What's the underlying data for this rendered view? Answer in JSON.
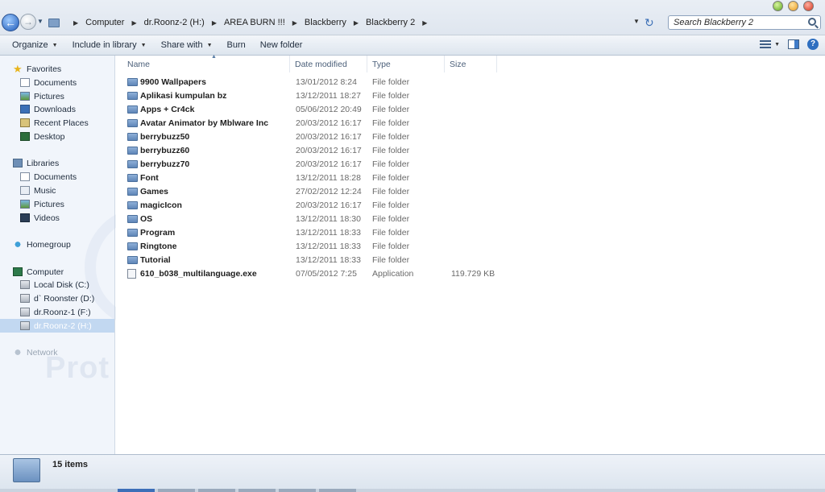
{
  "breadcrumb": [
    "Computer",
    "dr.Roonz-2 (H:)",
    "AREA BURN !!!",
    "Blackberry",
    "Blackberry 2"
  ],
  "search": {
    "placeholder": "Search Blackberry 2"
  },
  "toolbar": {
    "organize": "Organize",
    "include_in_library": "Include in library",
    "share_with": "Share with",
    "burn": "Burn",
    "new_folder": "New folder"
  },
  "nav": {
    "favorites": {
      "label": "Favorites",
      "items": [
        "Documents",
        "Pictures",
        "Downloads",
        "Recent Places",
        "Desktop"
      ]
    },
    "libraries": {
      "label": "Libraries",
      "items": [
        "Documents",
        "Music",
        "Pictures",
        "Videos"
      ]
    },
    "homegroup": "Homegroup",
    "computer": {
      "label": "Computer",
      "items": [
        "Local Disk (C:)",
        "d` Roonster (D:)",
        "dr.Roonz-1 (F:)",
        "dr.Roonz-2 (H:)"
      ]
    },
    "network": "Network"
  },
  "columns": {
    "name": "Name",
    "date": "Date modified",
    "type": "Type",
    "size": "Size"
  },
  "files": [
    {
      "name": "9900 Wallpapers",
      "date": "13/01/2012 8:24",
      "type": "File folder",
      "size": ""
    },
    {
      "name": "Aplikasi kumpulan bz",
      "date": "13/12/2011 18:27",
      "type": "File folder",
      "size": ""
    },
    {
      "name": "Apps + Cr4ck",
      "date": "05/06/2012 20:49",
      "type": "File folder",
      "size": ""
    },
    {
      "name": "Avatar Animator by Mblware Inc",
      "date": "20/03/2012 16:17",
      "type": "File folder",
      "size": ""
    },
    {
      "name": "berrybuzz50",
      "date": "20/03/2012 16:17",
      "type": "File folder",
      "size": ""
    },
    {
      "name": "berrybuzz60",
      "date": "20/03/2012 16:17",
      "type": "File folder",
      "size": ""
    },
    {
      "name": "berrybuzz70",
      "date": "20/03/2012 16:17",
      "type": "File folder",
      "size": ""
    },
    {
      "name": "Font",
      "date": "13/12/2011 18:28",
      "type": "File folder",
      "size": ""
    },
    {
      "name": "Games",
      "date": "27/02/2012 12:24",
      "type": "File folder",
      "size": ""
    },
    {
      "name": "magicIcon",
      "date": "20/03/2012 16:17",
      "type": "File folder",
      "size": ""
    },
    {
      "name": "OS",
      "date": "13/12/2011 18:30",
      "type": "File folder",
      "size": ""
    },
    {
      "name": "Program",
      "date": "13/12/2011 18:33",
      "type": "File folder",
      "size": ""
    },
    {
      "name": "Ringtone",
      "date": "13/12/2011 18:33",
      "type": "File folder",
      "size": ""
    },
    {
      "name": "Tutorial",
      "date": "13/12/2011 18:33",
      "type": "File folder",
      "size": ""
    },
    {
      "name": "610_b038_multilanguage.exe",
      "date": "07/05/2012 7:25",
      "type": "Application",
      "size": "119.729 KB"
    }
  ],
  "status": {
    "item_count": "15 items"
  },
  "watermark": "Prot"
}
